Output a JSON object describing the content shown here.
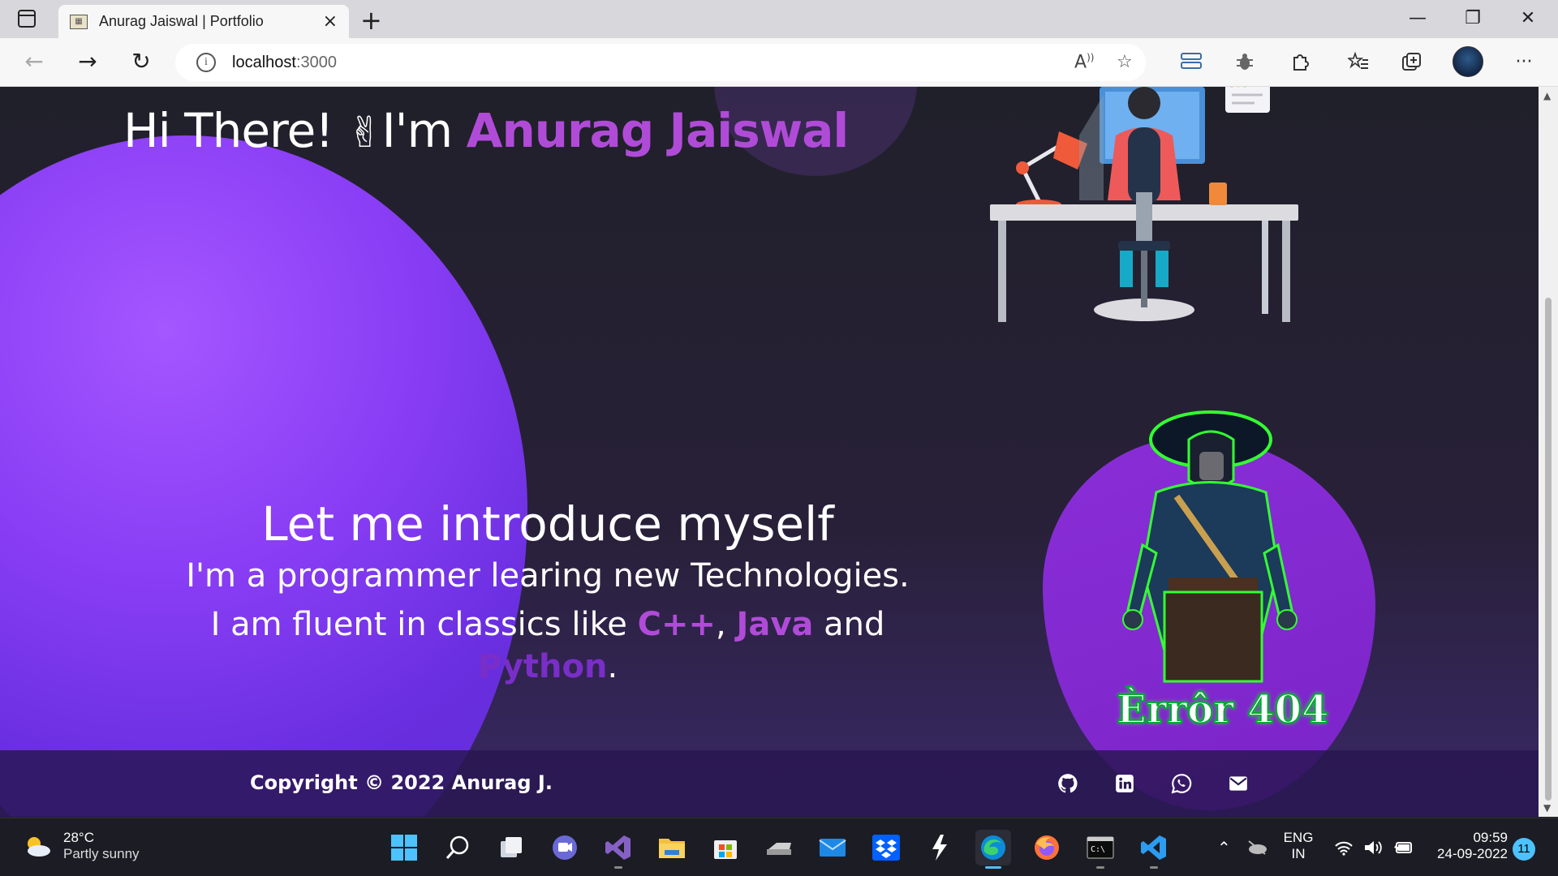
{
  "browser": {
    "tab_title": "Anurag Jaiswal | Portfolio",
    "url_host": "localhost",
    "url_port": ":3000",
    "new_tab": "+",
    "close_tab": "×"
  },
  "hero": {
    "greeting": "Hi There! ",
    "wave_emoji": "✌",
    "im": "I'm ",
    "name": "Anurag Jaiswal"
  },
  "intro": {
    "title": "Let me introduce myself",
    "line1": "I'm a programmer learing new Technologies.",
    "line2_prefix": "I am fluent in classics like ",
    "lang1": "C++",
    "sep1": ", ",
    "lang2": "Java",
    "sep2": " and ",
    "lang3": "Python",
    "suffix": "."
  },
  "avatar_caption": "Èrrôr 404",
  "footer": {
    "copyright": "Copyright © 2022 Anurag J.",
    "social": [
      "github-icon",
      "linkedin-icon",
      "whatsapp-icon",
      "mail-icon"
    ]
  },
  "taskbar": {
    "temp": "28°C",
    "weather": "Partly sunny",
    "lang_top": "ENG",
    "lang_bottom": "IN",
    "time": "09:59",
    "date": "24-09-2022",
    "notifications": "11"
  },
  "colors": {
    "accent": "#b04bd8",
    "blob": "#8a3ef5",
    "background": "#20202a"
  }
}
